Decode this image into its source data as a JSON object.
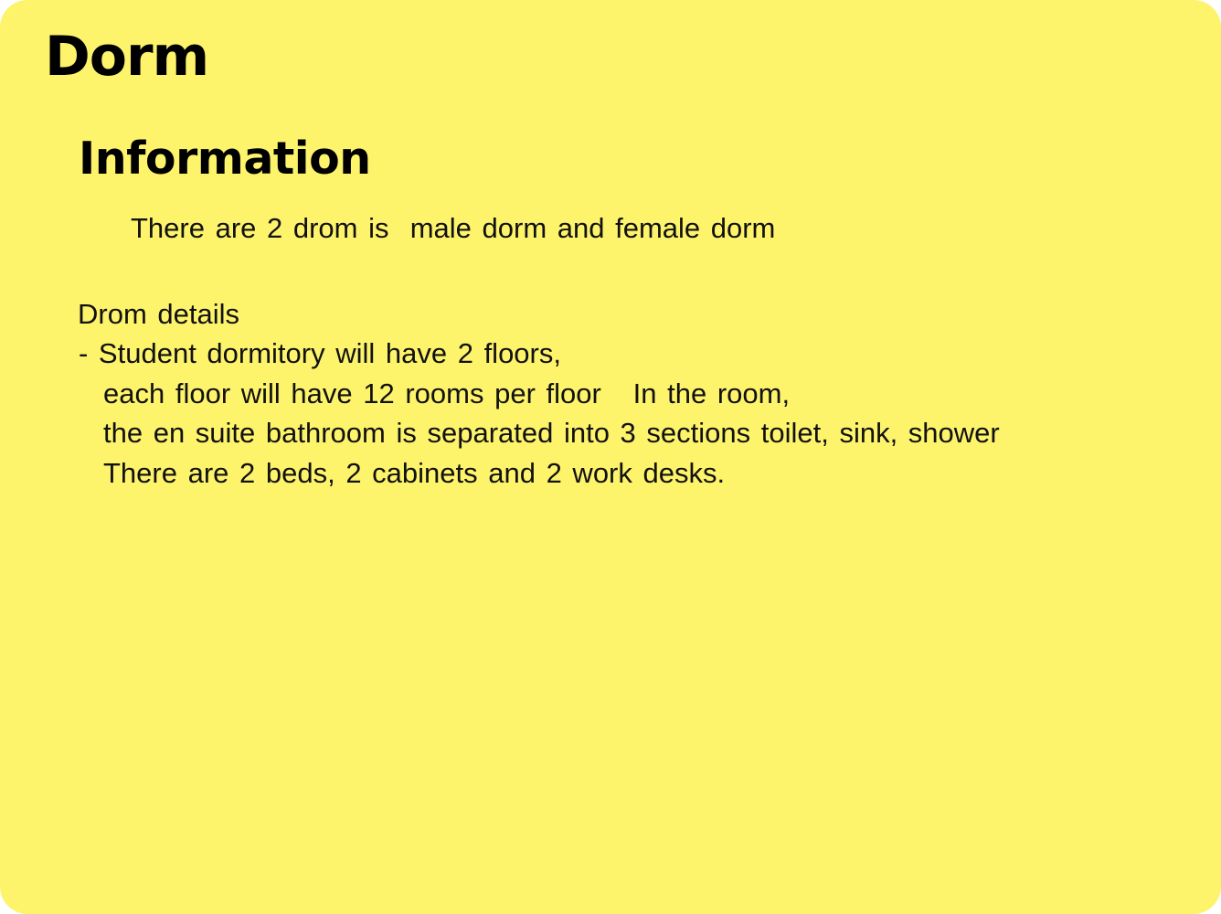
{
  "page": {
    "title": "Dorm",
    "section_title": "Information",
    "intro": "There are 2 drom is  male dorm and female dorm",
    "details_heading": "Drom details",
    "details": [
      "- Student dormitory will have 2 floors,",
      "each floor will have 12 rooms per floor   In the room,",
      "the en suite bathroom is separated into 3 sections toilet, sink, shower",
      "There are 2 beds, 2 cabinets and 2 work desks."
    ]
  },
  "colors": {
    "background": "#fef46c",
    "text": "#000000"
  }
}
